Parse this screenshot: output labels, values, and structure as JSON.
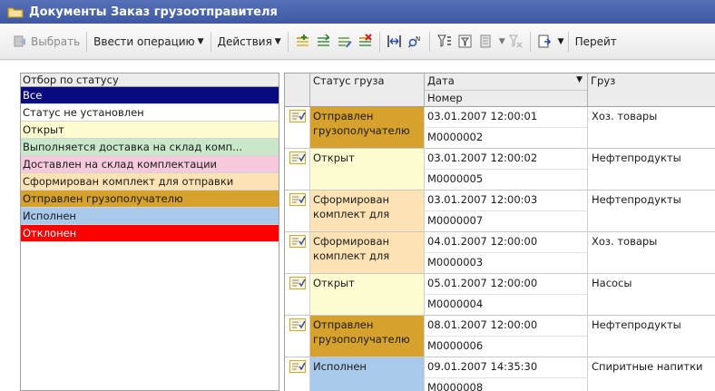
{
  "window": {
    "title": "Документы Заказ грузоотправителя"
  },
  "toolbar": {
    "select_label": "Выбрать",
    "enter_operation_label": "Ввести операцию",
    "actions_label": "Действия",
    "goto_label": "Перейт"
  },
  "filter": {
    "header": "Отбор по статусу",
    "items": [
      {
        "label": "Все",
        "bg": "#0a0a80",
        "fg": "#ffffff"
      },
      {
        "label": "Статус не установлен",
        "bg": "#ffffff",
        "fg": "#1a1a1a"
      },
      {
        "label": "Открыт",
        "bg": "#fdfbd0",
        "fg": "#1a1a1a"
      },
      {
        "label": "Выполняется доставка на склад комп...",
        "bg": "#c9e7c9",
        "fg": "#1a1a1a"
      },
      {
        "label": "Доставлен на склад комплектации",
        "bg": "#f7c9dc",
        "fg": "#1a1a1a"
      },
      {
        "label": "Сформирован комплект для отправки",
        "bg": "#fde2b4",
        "fg": "#1a1a1a"
      },
      {
        "label": "Отправлен грузополучателю",
        "bg": "#d6a12c",
        "fg": "#1a1a1a"
      },
      {
        "label": "Исполнен",
        "bg": "#a8c9ea",
        "fg": "#1a1a1a"
      },
      {
        "label": "Отклонен",
        "bg": "#ff0000",
        "fg": "#ffffff"
      }
    ]
  },
  "grid": {
    "headers": {
      "status": "Статус груза",
      "date": "Дата",
      "number": "Номер",
      "cargo": "Груз"
    },
    "rows": [
      {
        "status": "Отправлен грузополучателю",
        "status_bg": "#d6a12c",
        "date": "03.01.2007 12:00:01",
        "number": "М0000002",
        "cargo": "Хоз. товары"
      },
      {
        "status": "Открыт",
        "status_bg": "#fdfbd0",
        "date": "03.01.2007 12:00:02",
        "number": "М0000005",
        "cargo": "Нефтепродукты"
      },
      {
        "status": "Сформирован комплект для",
        "status_bg": "#fde2b4",
        "date": "03.01.2007 12:00:03",
        "number": "М0000007",
        "cargo": "Нефтепродукты"
      },
      {
        "status": "Сформирован комплект для",
        "status_bg": "#fde2b4",
        "date": "04.01.2007 12:00:00",
        "number": "М0000003",
        "cargo": "Хоз. товары"
      },
      {
        "status": "Открыт",
        "status_bg": "#fdfbd0",
        "date": "05.01.2007 12:00:00",
        "number": "М0000004",
        "cargo": "Насосы"
      },
      {
        "status": "Отправлен грузополучателю",
        "status_bg": "#d6a12c",
        "date": "08.01.2007 12:00:00",
        "number": "М0000006",
        "cargo": "Нефтепродукты"
      },
      {
        "status": "Исполнен",
        "status_bg": "#a8c9ea",
        "date": "09.01.2007 14:35:30",
        "number": "М0000008",
        "cargo": "Спиритные напитки"
      }
    ]
  },
  "colors": {
    "titlebar": "#4862ad",
    "document_icon": "#c9a733"
  }
}
